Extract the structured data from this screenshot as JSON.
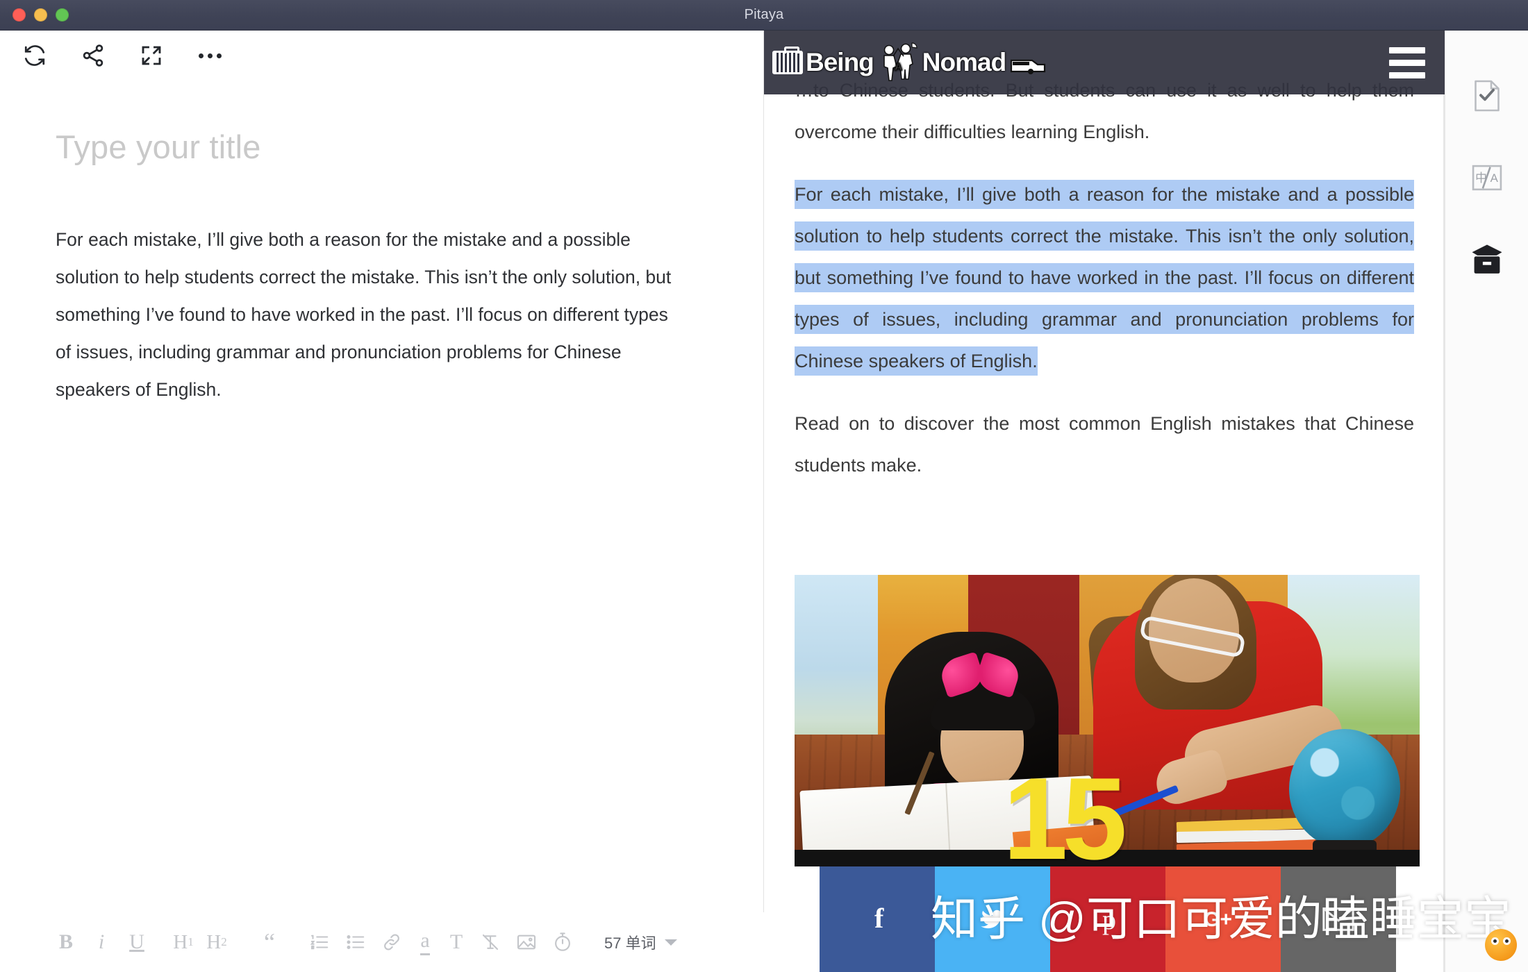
{
  "window": {
    "title": "Pitaya",
    "traffic_lights": [
      "close",
      "minimize",
      "zoom"
    ]
  },
  "editor": {
    "toolbar": [
      {
        "name": "sync-icon",
        "label": "Sync"
      },
      {
        "name": "share-icon",
        "label": "Share"
      },
      {
        "name": "fullscreen-icon",
        "label": "Fullscreen"
      },
      {
        "name": "more-icon",
        "label": "More"
      }
    ],
    "title_placeholder": "Type your title",
    "body": "For each mistake, I’ll give both a reason for the mistake and a possible solution to help students correct the mistake. This isn’t the only solution, but something I’ve found to have worked in the past. I’ll focus on different types of issues, including grammar and pronunciation problems for Chinese speakers of English.",
    "format_bar": {
      "bold": "B",
      "italic": "i",
      "underline": "U",
      "heading1": "H",
      "heading1_sub": "1",
      "heading2": "H",
      "heading2_sub": "2",
      "blockquote": "“",
      "ordered_list": "ordered-list-icon",
      "bullet_list": "bullet-list-icon",
      "link": "link-icon",
      "highlight": "a",
      "text_style": "T",
      "clear_format": "clear-format-icon",
      "image": "image-icon",
      "timer": "timer-icon",
      "word_count": "57 单词"
    }
  },
  "preview": {
    "site_logo": {
      "text_1": "Being",
      "text_2": "A",
      "text_3": "Nomad"
    },
    "menu_label": "hamburger-menu",
    "paragraphs": [
      {
        "id": "p1",
        "text": "…to Chinese students. But students can use it as well to help them overcome their difficulties learning English.",
        "selected": false
      },
      {
        "id": "p2",
        "text": "For each mistake, I’ll give both a reason for the mistake and a possible solution to help students correct the mistake. This isn’t the only solution, but something I’ve found to have worked in the past. I’ll focus on different types of issues, including grammar and pronunciation problems for Chinese speakers of English.",
        "selected": true
      },
      {
        "id": "p3",
        "text": "Read on to discover the most common English mistakes that Chinese students make.",
        "selected": false
      }
    ],
    "image": {
      "name": "tutoring-photo",
      "alt": "A woman in a red shirt tutoring a young girl in a pink polka-dot top at a wooden desk with books and a globe",
      "badge": "15"
    },
    "social_buttons": [
      {
        "name": "facebook-share-button",
        "glyph": "f",
        "color": "#3b5998"
      },
      {
        "name": "twitter-share-button",
        "glyph": "t",
        "color": "#4ab3f4"
      },
      {
        "name": "pinterest-share-button",
        "glyph": "p",
        "color": "#c8232c"
      },
      {
        "name": "googleplus-share-button",
        "glyph": "G+",
        "color": "#e8503a"
      },
      {
        "name": "email-share-button",
        "glyph": "✉",
        "color": "#666666"
      }
    ]
  },
  "rail": {
    "items": [
      {
        "name": "grammar-check-icon",
        "label": "Check"
      },
      {
        "name": "translate-icon",
        "label": "中/A"
      },
      {
        "name": "archive-icon",
        "label": "Archive"
      }
    ]
  },
  "watermark": {
    "text": "知乎 @可口可爱的瞌睡宝宝"
  },
  "colors": {
    "titlebar": "#3f4356",
    "selection": "#aecbf4",
    "header_overlay": "#30323e",
    "placeholder": "#c9c9c9"
  }
}
